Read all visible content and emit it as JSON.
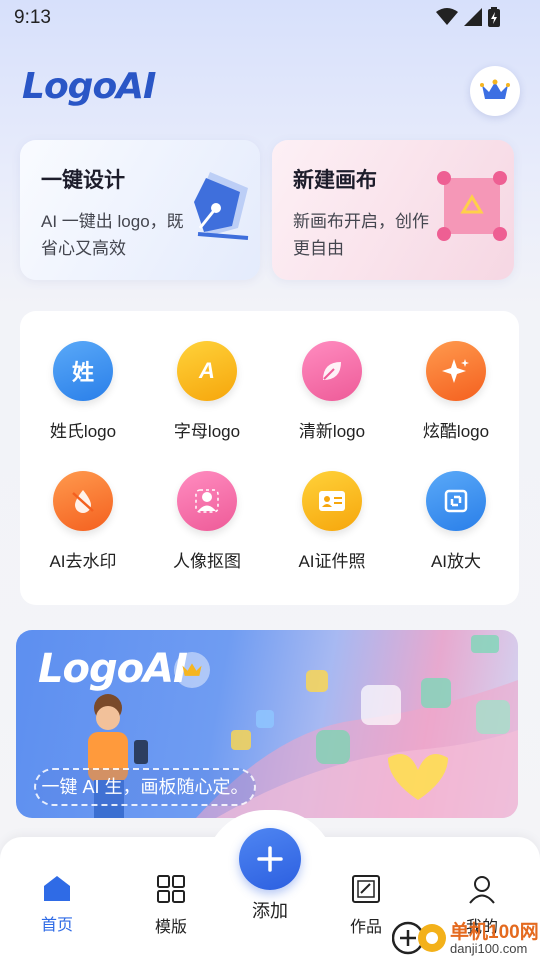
{
  "status_bar": {
    "time": "9:13"
  },
  "header": {
    "logo_text": "LogoAI"
  },
  "cards": [
    {
      "title": "一键设计",
      "desc": "AI 一键出 logo，既省心又高效"
    },
    {
      "title": "新建画布",
      "desc": "新画布开启，创作更自由"
    }
  ],
  "tools": [
    {
      "label": "姓氏logo",
      "glyph": "姓",
      "icon": "surname-icon",
      "color": "#2f8ff3"
    },
    {
      "label": "字母logo",
      "glyph": "A",
      "icon": "letter-icon",
      "color": "#f8b512"
    },
    {
      "label": "清新logo",
      "glyph": "",
      "icon": "leaf-icon",
      "color": "#f06aa4"
    },
    {
      "label": "炫酷logo",
      "glyph": "",
      "icon": "sparkle-icon",
      "color": "#fb6a2d"
    },
    {
      "label": "AI去水印",
      "glyph": "",
      "icon": "watermark-remove-icon",
      "color": "#fb6a2d"
    },
    {
      "label": "人像抠图",
      "glyph": "",
      "icon": "portrait-cutout-icon",
      "color": "#f06aa4"
    },
    {
      "label": "AI证件照",
      "glyph": "",
      "icon": "id-photo-icon",
      "color": "#f8b512"
    },
    {
      "label": "AI放大",
      "glyph": "",
      "icon": "enlarge-icon",
      "color": "#2f8ff3"
    }
  ],
  "banner": {
    "logo_text": "LogoAI",
    "slogan": "一键 AI 生，画板随心定。"
  },
  "nav": {
    "home": "首页",
    "templates": "模版",
    "add": "添加",
    "works": "作品",
    "mine": "我的"
  },
  "watermark": {
    "top": "单机100网",
    "bottom": "danji100.com"
  },
  "colors": {
    "accent": "#2f6be6",
    "logo": "#2a56c6"
  }
}
